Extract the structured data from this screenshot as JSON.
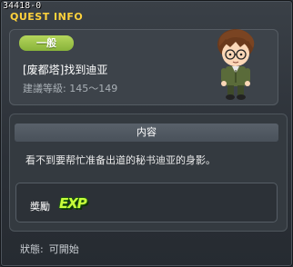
{
  "window": {
    "quest_id": "34418-0",
    "title": "QUEST INFO"
  },
  "header": {
    "category_badge": "一般",
    "quest_name": "[废都塔]找到迪亚",
    "level_label": "建議等級:",
    "level_range": "145～149",
    "avatar_icon": "character-portrait-icon"
  },
  "content": {
    "section_title": "内容",
    "description": "看不到要帮忙准备出道的秘书迪亚的身影。"
  },
  "reward": {
    "label": "奬勵",
    "icon": "exp-icon",
    "icon_text": "EXP"
  },
  "status": {
    "label": "狀態:",
    "value": "可開始"
  },
  "colors": {
    "title_accent": "#ffd23c",
    "badge_green": "#9cc34a",
    "exp_green": "#c7ff3a"
  }
}
